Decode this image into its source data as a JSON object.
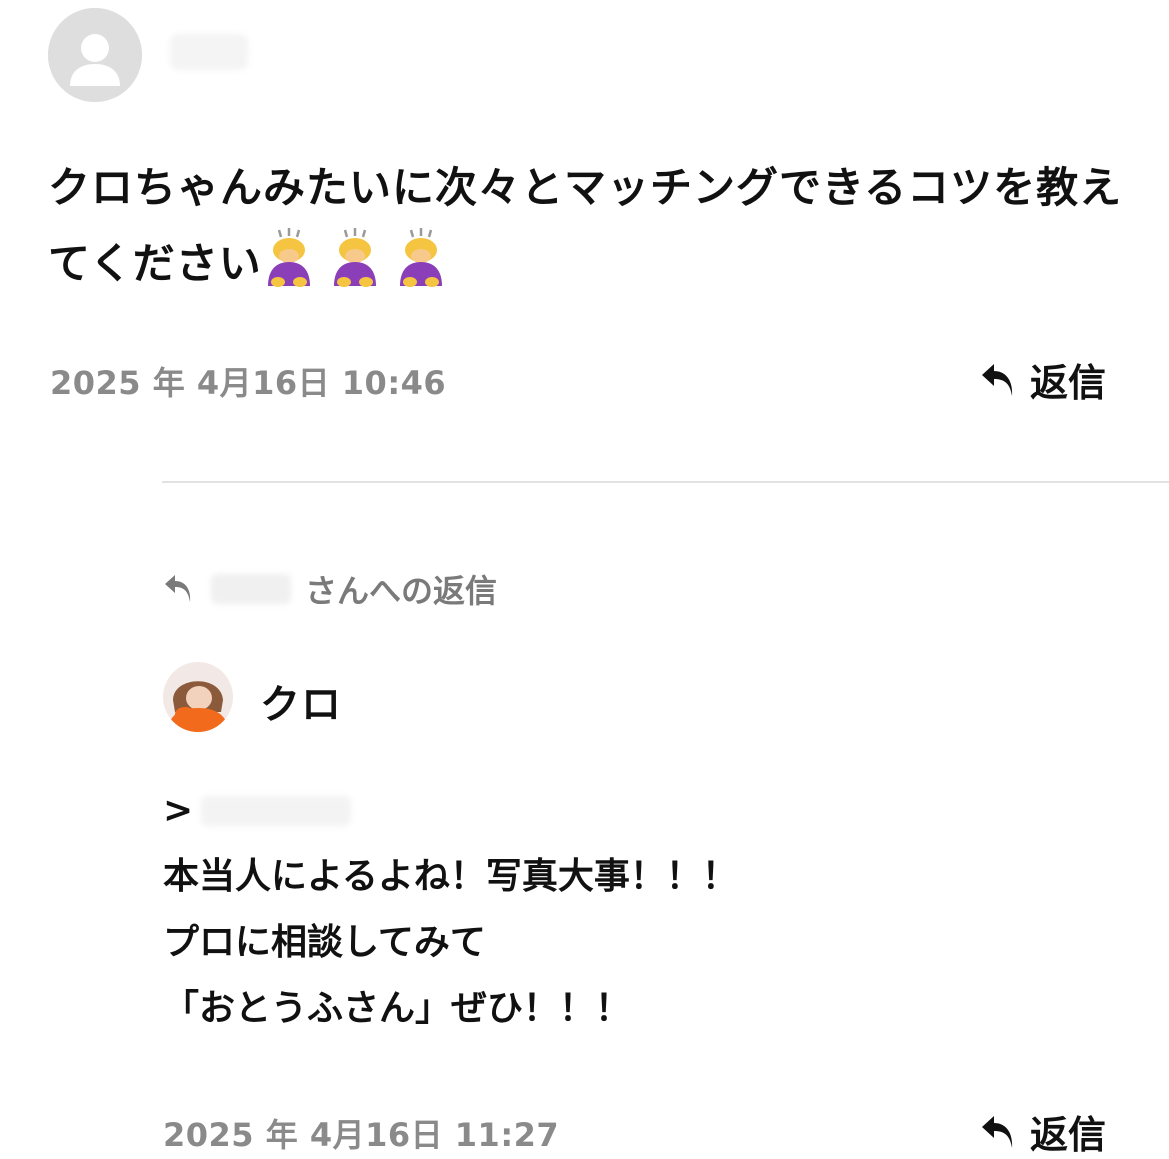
{
  "comment": {
    "text": "クロちゃんみたいに次々とマッチングできるコツを教えてください",
    "emoji_name": "person-bowing-emoji",
    "emoji_count": 3,
    "timestamp": "2025 年 4月16日 10:46",
    "reply_label": "返信"
  },
  "reply": {
    "reply_to_suffix": "さんへの返信",
    "author_name": "クロ",
    "quote_prefix": ">",
    "lines": [
      "本当人によるよね！写真大事！！！",
      "プロに相談してみて",
      "「おとうふさん」ぜひ！！！"
    ],
    "timestamp": "2025 年 4月16日 11:27",
    "reply_label": "返信"
  },
  "colors": {
    "text": "#111111",
    "muted": "#8a8a8a",
    "divider": "#e2e2e2",
    "avatar_default": "#dedede",
    "accent_orange": "#f26a1b"
  }
}
